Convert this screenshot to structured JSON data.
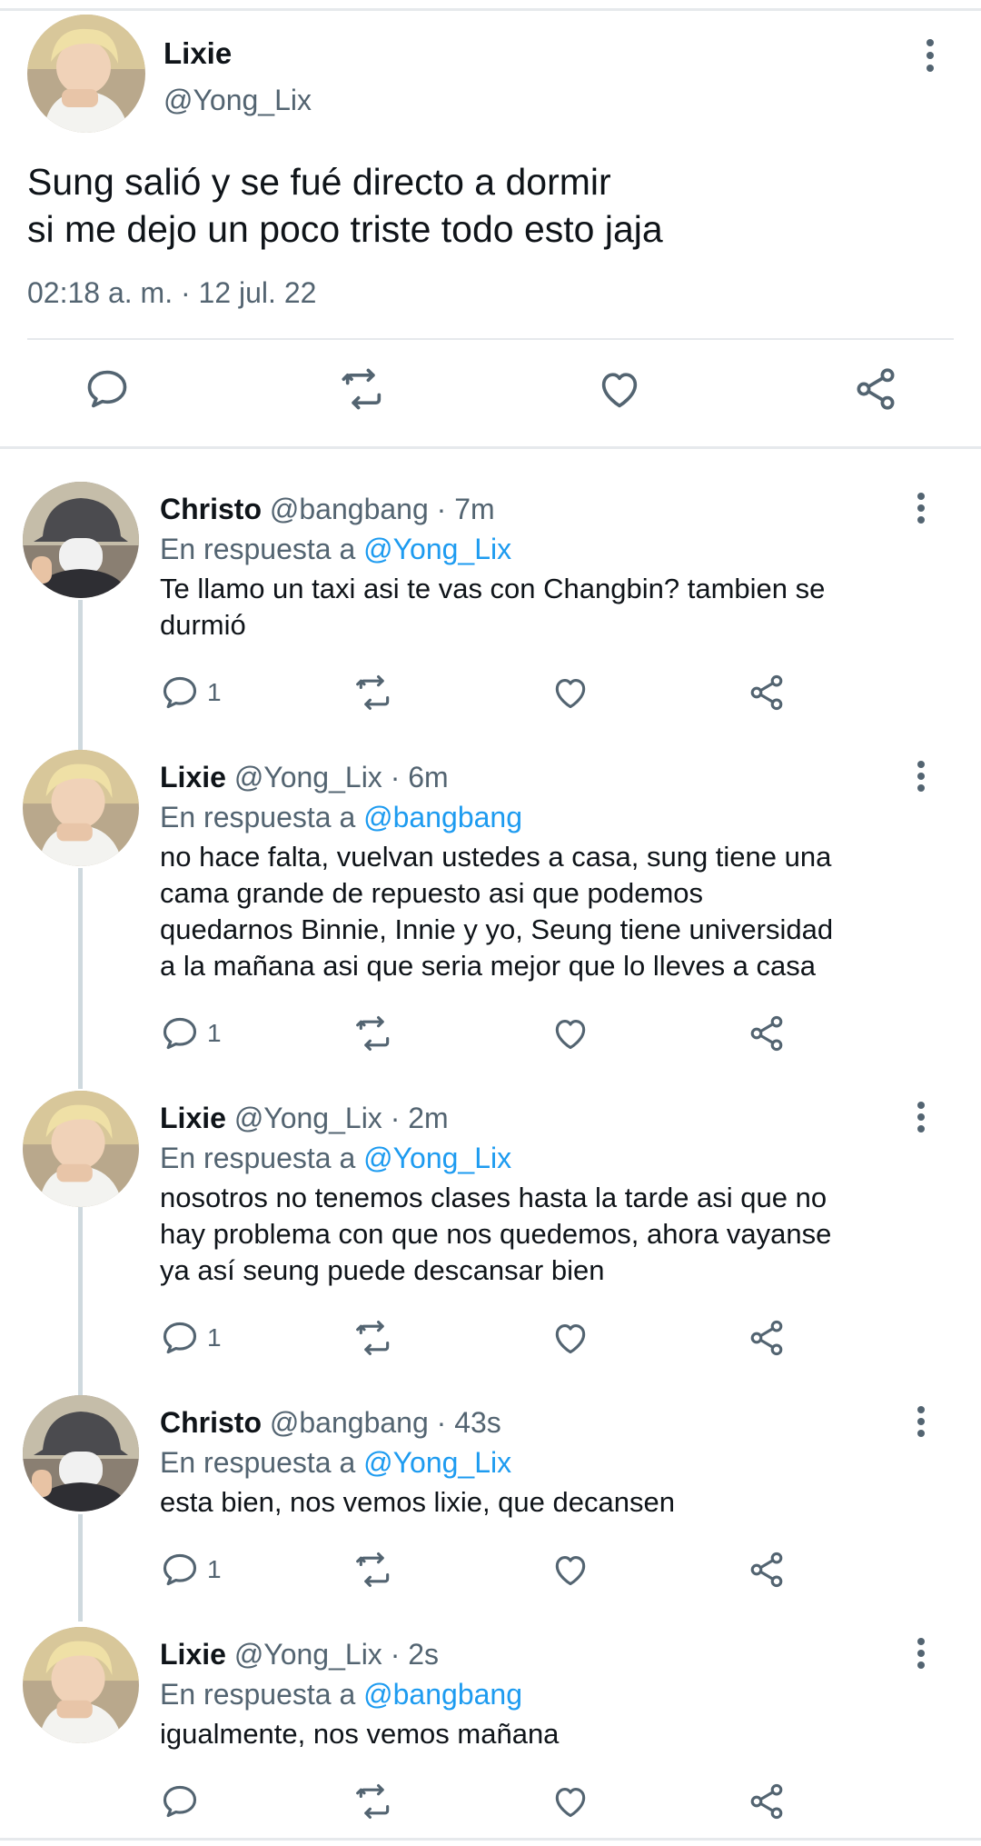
{
  "main_tweet": {
    "name": "Lixie",
    "handle": "@Yong_Lix",
    "text_lines": [
      "Sung salió y se fué directo a dormir",
      "si me dejo un poco triste todo esto jaja"
    ],
    "timestamp": "02:18 a. m. · 12 jul. 22",
    "avatar": "lixie-avatar",
    "actions": [
      "reply-icon",
      "retweet-icon",
      "like-icon",
      "share-icon"
    ]
  },
  "replies": [
    {
      "name": "Christo",
      "handle": "@bangbang · 7m",
      "reply_to_label": "En respuesta a",
      "reply_to": "@Yong_Lix",
      "text_lines": [
        "Te llamo un taxi asi te vas con Changbin? tambien se",
        "durmió"
      ],
      "reply_count": "1",
      "avatar": "christo-avatar"
    },
    {
      "name": "Lixie",
      "handle": "@Yong_Lix · 6m",
      "reply_to_label": "En respuesta a",
      "reply_to": "@bangbang",
      "text_lines": [
        "no hace falta, vuelvan ustedes a casa, sung tiene una",
        "cama grande de repuesto asi que podemos",
        "quedarnos Binnie, Innie y yo, Seung tiene universidad",
        "a la mañana asi que seria mejor que lo lleves a casa"
      ],
      "reply_count": "1",
      "avatar": "lixie-avatar"
    },
    {
      "name": "Lixie",
      "handle": "@Yong_Lix · 2m",
      "reply_to_label": "En respuesta a",
      "reply_to": "@Yong_Lix",
      "text_lines": [
        "nosotros no tenemos clases hasta la tarde asi que no",
        "hay problema con que nos quedemos, ahora vayanse",
        "ya así seung puede descansar bien"
      ],
      "reply_count": "1",
      "avatar": "lixie-avatar"
    },
    {
      "name": "Christo",
      "handle": "@bangbang · 43s",
      "reply_to_label": "En respuesta a",
      "reply_to": "@Yong_Lix",
      "text_lines": [
        "esta bien, nos vemos lixie, que decansen"
      ],
      "reply_count": "1",
      "avatar": "christo-avatar"
    },
    {
      "name": "Lixie",
      "handle": "@Yong_Lix · 2s",
      "reply_to_label": "En respuesta a",
      "reply_to": "@bangbang",
      "text_lines": [
        "igualmente, nos vemos mañana"
      ],
      "reply_count": "",
      "avatar": "lixie-avatar"
    }
  ],
  "colors": {
    "text": "#0f1419",
    "secondary": "#536471",
    "link": "#1d9bf0",
    "divider": "#e6e9ec",
    "thread_line": "#cfd9de"
  }
}
